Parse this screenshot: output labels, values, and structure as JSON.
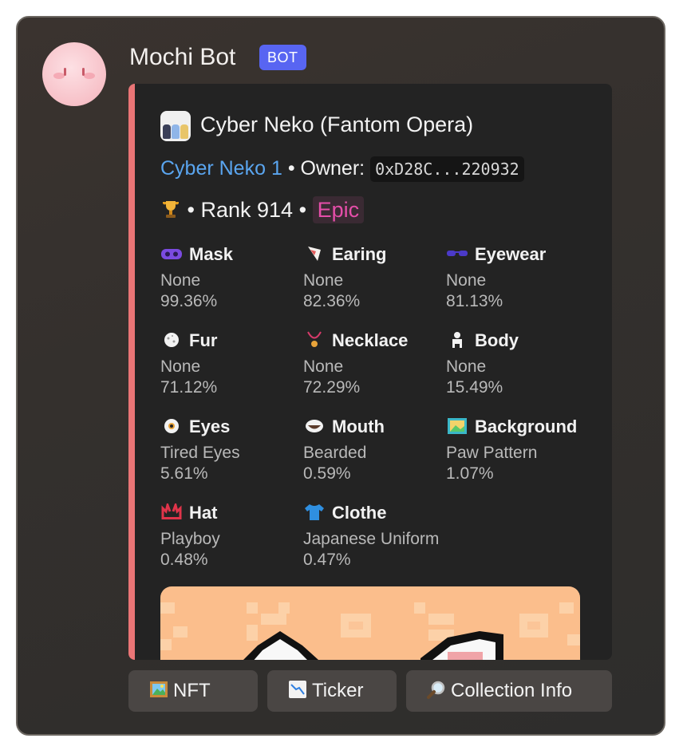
{
  "message": {
    "author": "Mochi Bot",
    "badge": "BOT"
  },
  "embed": {
    "accent_color": "#ea7576",
    "title": "Cyber Neko (Fantom Opera)",
    "token_name": "Cyber Neko 1",
    "separator": "•",
    "owner_label": "Owner:",
    "owner_address": "0xD28C...220932",
    "trophy_icon": "trophy-icon",
    "rank_text": "Rank 914",
    "rarity": "Epic",
    "rarity_color": "#e54ea9",
    "link_color": "#5aa5ef",
    "traits": [
      {
        "name": "Mask",
        "icon": "mask-icon",
        "value": "None",
        "percent": "99.36%"
      },
      {
        "name": "Earing",
        "icon": "earing-icon",
        "value": "None",
        "percent": "82.36%"
      },
      {
        "name": "Eyewear",
        "icon": "eyewear-icon",
        "value": "None",
        "percent": "81.13%"
      },
      {
        "name": "Fur",
        "icon": "fur-icon",
        "value": "None",
        "percent": "71.12%"
      },
      {
        "name": "Necklace",
        "icon": "necklace-icon",
        "value": "None",
        "percent": "72.29%"
      },
      {
        "name": "Body",
        "icon": "body-icon",
        "value": "None",
        "percent": "15.49%"
      },
      {
        "name": "Eyes",
        "icon": "eyes-icon",
        "value": "Tired Eyes",
        "percent": "5.61%"
      },
      {
        "name": "Mouth",
        "icon": "mouth-icon",
        "value": "Bearded",
        "percent": "0.59%"
      },
      {
        "name": "Background",
        "icon": "background-icon",
        "value": "Paw Pattern",
        "percent": "1.07%"
      },
      {
        "name": "Hat",
        "icon": "hat-icon",
        "value": "Playboy",
        "percent": "0.48%"
      },
      {
        "name": "Clothe",
        "icon": "clothe-icon",
        "value": "Japanese Uniform",
        "percent": "0.47%"
      }
    ]
  },
  "buttons": [
    {
      "label": "NFT",
      "icon": "framed-picture-icon"
    },
    {
      "label": "Ticker",
      "icon": "chart-decreasing-icon"
    },
    {
      "label": "Collection Info",
      "icon": "magnifying-glass-icon"
    }
  ]
}
